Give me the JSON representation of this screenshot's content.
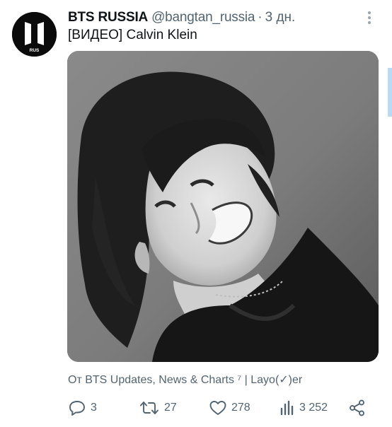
{
  "account": {
    "display_name": "BTS RUSSIA",
    "handle": "@bangtan_russia",
    "separator": "·",
    "time": "3 дн.",
    "avatar_text": "RUS"
  },
  "tweet": {
    "text": "[ВИДЕО] Calvin Klein",
    "media": {
      "type": "video",
      "muted": true,
      "mute_icon": "speaker-muted-icon"
    },
    "source": "От BTS Updates, News & Charts ⁷ | Layo(✓)er"
  },
  "actions": {
    "replies": "3",
    "retweets": "27",
    "likes": "278",
    "views": "3 252"
  },
  "colors": {
    "text_primary": "#0f1419",
    "text_secondary": "#536471",
    "avatar_bg": "#0b0b0b",
    "scroll_accent": "#b9d9f5"
  }
}
